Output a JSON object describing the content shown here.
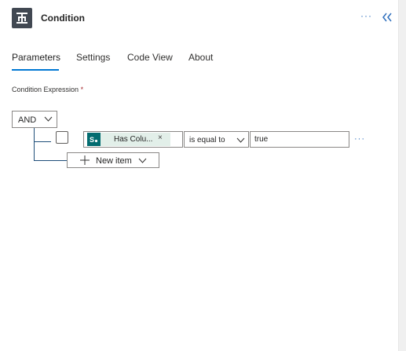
{
  "header": {
    "title": "Condition",
    "action_icon": "condition-icon",
    "more_label": "···",
    "collapse_icon": "double-chevron-left-icon",
    "accent_color": "#414852"
  },
  "tabs": [
    {
      "label": "Parameters",
      "active": true
    },
    {
      "label": "Settings",
      "active": false
    },
    {
      "label": "Code View",
      "active": false
    },
    {
      "label": "About",
      "active": false
    }
  ],
  "condition": {
    "label": "Condition Expression",
    "required_mark": "*",
    "group_operator": "AND",
    "rows": [
      {
        "checked": false,
        "token_label": "Has Colu...",
        "token_icon": "sharepoint-icon",
        "token_close": "×",
        "operator": "is equal to",
        "value": "true",
        "more_label": "···"
      }
    ],
    "new_item_label": "New item"
  },
  "colors": {
    "tab_underline": "#0078d4",
    "tree_line": "#1f4e79",
    "token_bg": "#e2efe9",
    "token_icon_bg": "#036c70",
    "link": "#2f6fbd"
  }
}
